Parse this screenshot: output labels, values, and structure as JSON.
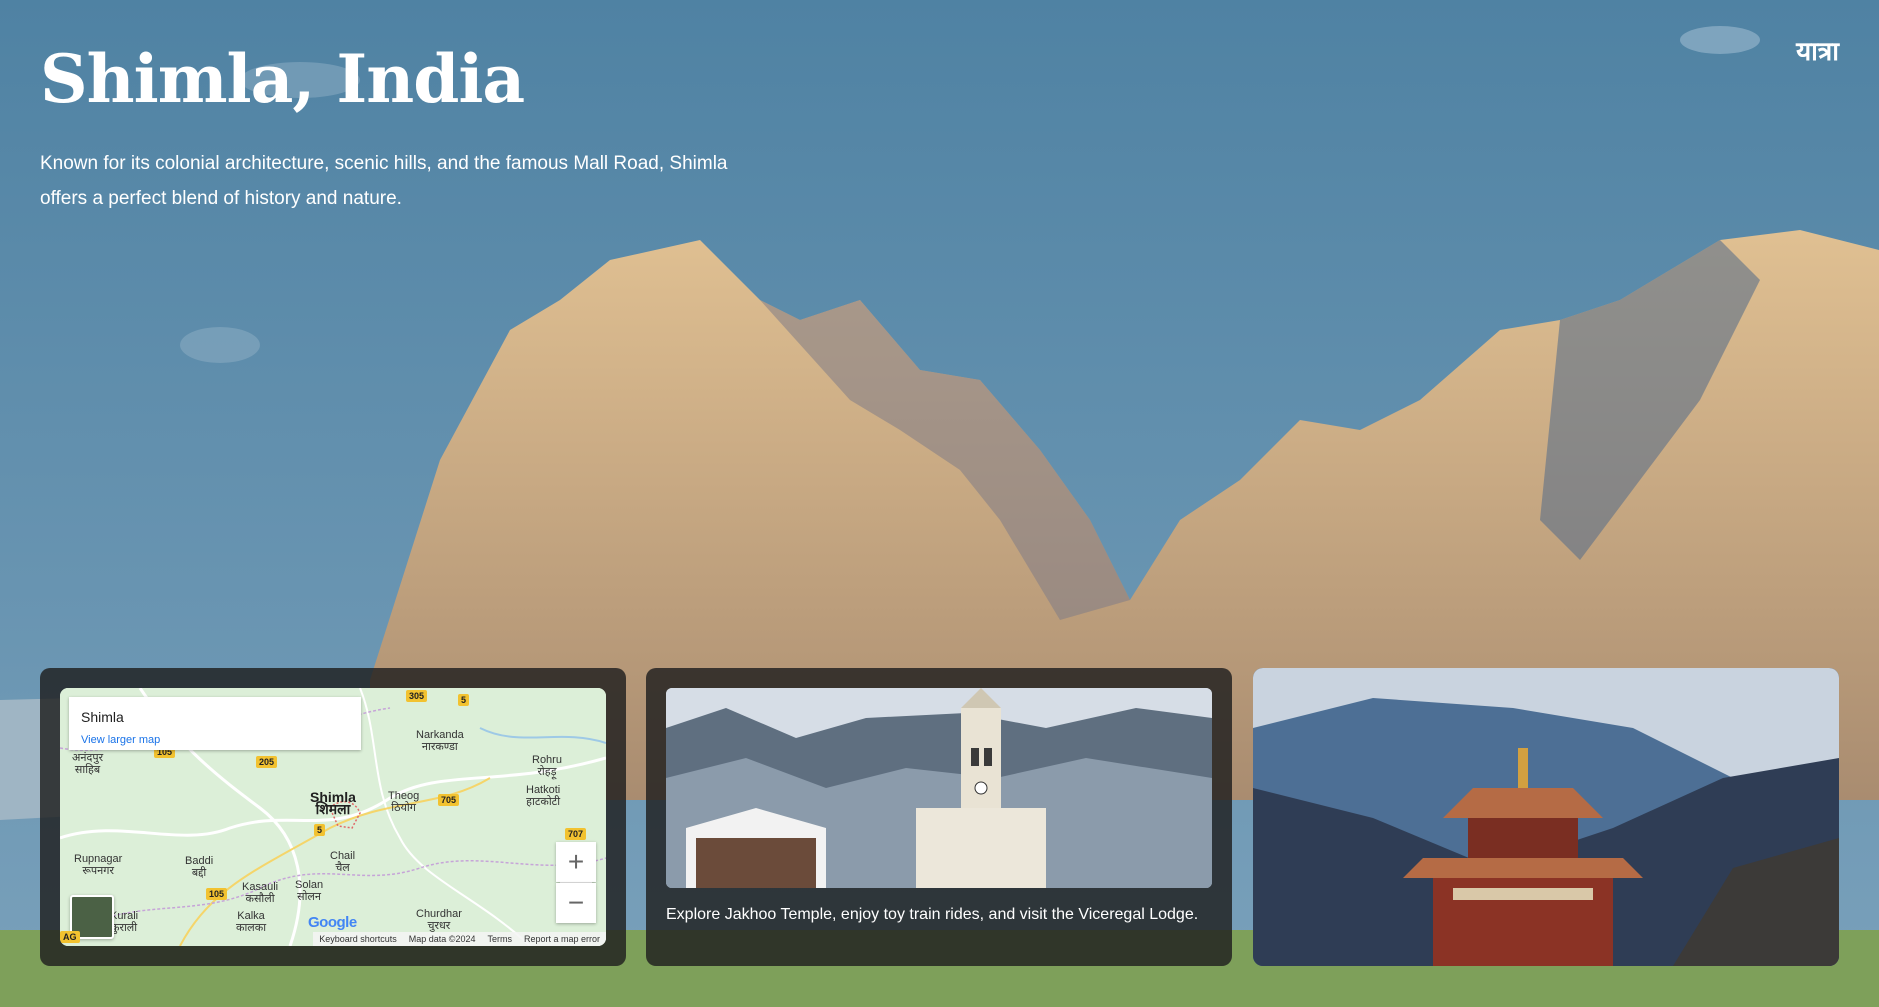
{
  "hero": {
    "title": "Shimla, India",
    "description": "Known for its colonial architecture, scenic hills, and the famous Mall Road, Shimla offers a perfect blend of history and nature."
  },
  "brand": {
    "logo_text": "यात्रा"
  },
  "map": {
    "infobox": {
      "place": "Shimla",
      "link": "View larger map"
    },
    "labels": [
      {
        "text": "Shimla"
      },
      {
        "text": "शिमला"
      },
      {
        "text": "Narkanda"
      },
      {
        "text": "नारकण्डा"
      },
      {
        "text": "Rohru"
      },
      {
        "text": "रोहड़ू"
      },
      {
        "text": "Hatkoti"
      },
      {
        "text": "हाटकोटी"
      },
      {
        "text": "Theog"
      },
      {
        "text": "ठियोग"
      },
      {
        "text": "Chail"
      },
      {
        "text": "चैल"
      },
      {
        "text": "Solan"
      },
      {
        "text": "सोलन"
      },
      {
        "text": "Kasauli"
      },
      {
        "text": "कसौली"
      },
      {
        "text": "Baddi"
      },
      {
        "text": "बद्दी"
      },
      {
        "text": "Rupnagar"
      },
      {
        "text": "रूपनगर"
      },
      {
        "text": "Kalka"
      },
      {
        "text": "कालका"
      },
      {
        "text": "Churdhar"
      },
      {
        "text": "चुरधर"
      },
      {
        "text": "अनंदपुर"
      },
      {
        "text": "साहिब"
      },
      {
        "text": "Kurali"
      },
      {
        "text": "कुराली"
      }
    ],
    "shields": [
      "305",
      "5",
      "105",
      "205",
      "705",
      "707",
      "5",
      "105"
    ],
    "zoom_in": "+",
    "zoom_out": "−",
    "google": "Google",
    "attribution": {
      "shortcuts": "Keyboard shortcuts",
      "data": "Map data ©2024",
      "terms": "Terms",
      "report": "Report a map error"
    },
    "partial_label": "AG"
  },
  "info_card": {
    "text": "Explore Jakhoo Temple, enjoy toy train rides, and visit the Viceregal Lodge."
  },
  "colors": {
    "sky": "#5b8aa8",
    "card_bg": "#1e1e1e",
    "map_land": "#d9ecd6",
    "link": "#1a73e8"
  }
}
